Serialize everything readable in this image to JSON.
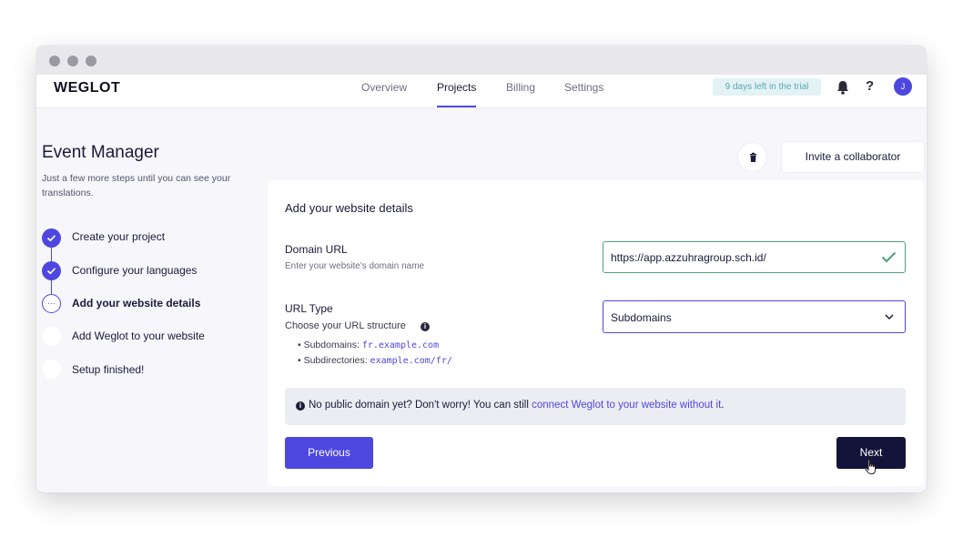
{
  "app": {
    "logo": "WEGLOT"
  },
  "nav": {
    "tabs": [
      {
        "label": "Overview"
      },
      {
        "label": "Projects"
      },
      {
        "label": "Billing"
      },
      {
        "label": "Settings"
      }
    ],
    "active_tab": "Projects",
    "trial_badge": "9 days left in the trial",
    "help_label": "?",
    "avatar_initial": "J",
    "accent_color": "#4d47e0"
  },
  "sidebar": {
    "title": "Event Manager",
    "subtitle": "Just a few more steps until you can see your translations.",
    "steps": [
      {
        "label": "Create your project",
        "status": "done"
      },
      {
        "label": "Configure your languages",
        "status": "done"
      },
      {
        "label": "Add your website details",
        "status": "current",
        "marker": "···"
      },
      {
        "label": "Add Weglot to your website",
        "status": "todo"
      },
      {
        "label": "Setup finished!",
        "status": "todo"
      }
    ]
  },
  "actions": {
    "invite_label": "Invite a collaborator"
  },
  "form": {
    "title": "Add your website details",
    "domain": {
      "label": "Domain URL",
      "help": "Enter your website's domain name",
      "value": "https://app.azzuhragroup.sch.id/"
    },
    "url_type": {
      "label": "URL Type",
      "help": "Choose your URL structure",
      "info_icon": "i",
      "selected": "Subdomains",
      "bullets": [
        {
          "label": "Subdomains: ",
          "example": "fr.example.com"
        },
        {
          "label": "Subdirectories: ",
          "example": "example.com/fr/"
        }
      ]
    },
    "notice": {
      "icon": "i",
      "text": "No public domain yet? Don't worry! You can still ",
      "link": "connect Weglot to your website without it",
      "end": "."
    },
    "previous_label": "Previous",
    "next_label": "Next"
  }
}
